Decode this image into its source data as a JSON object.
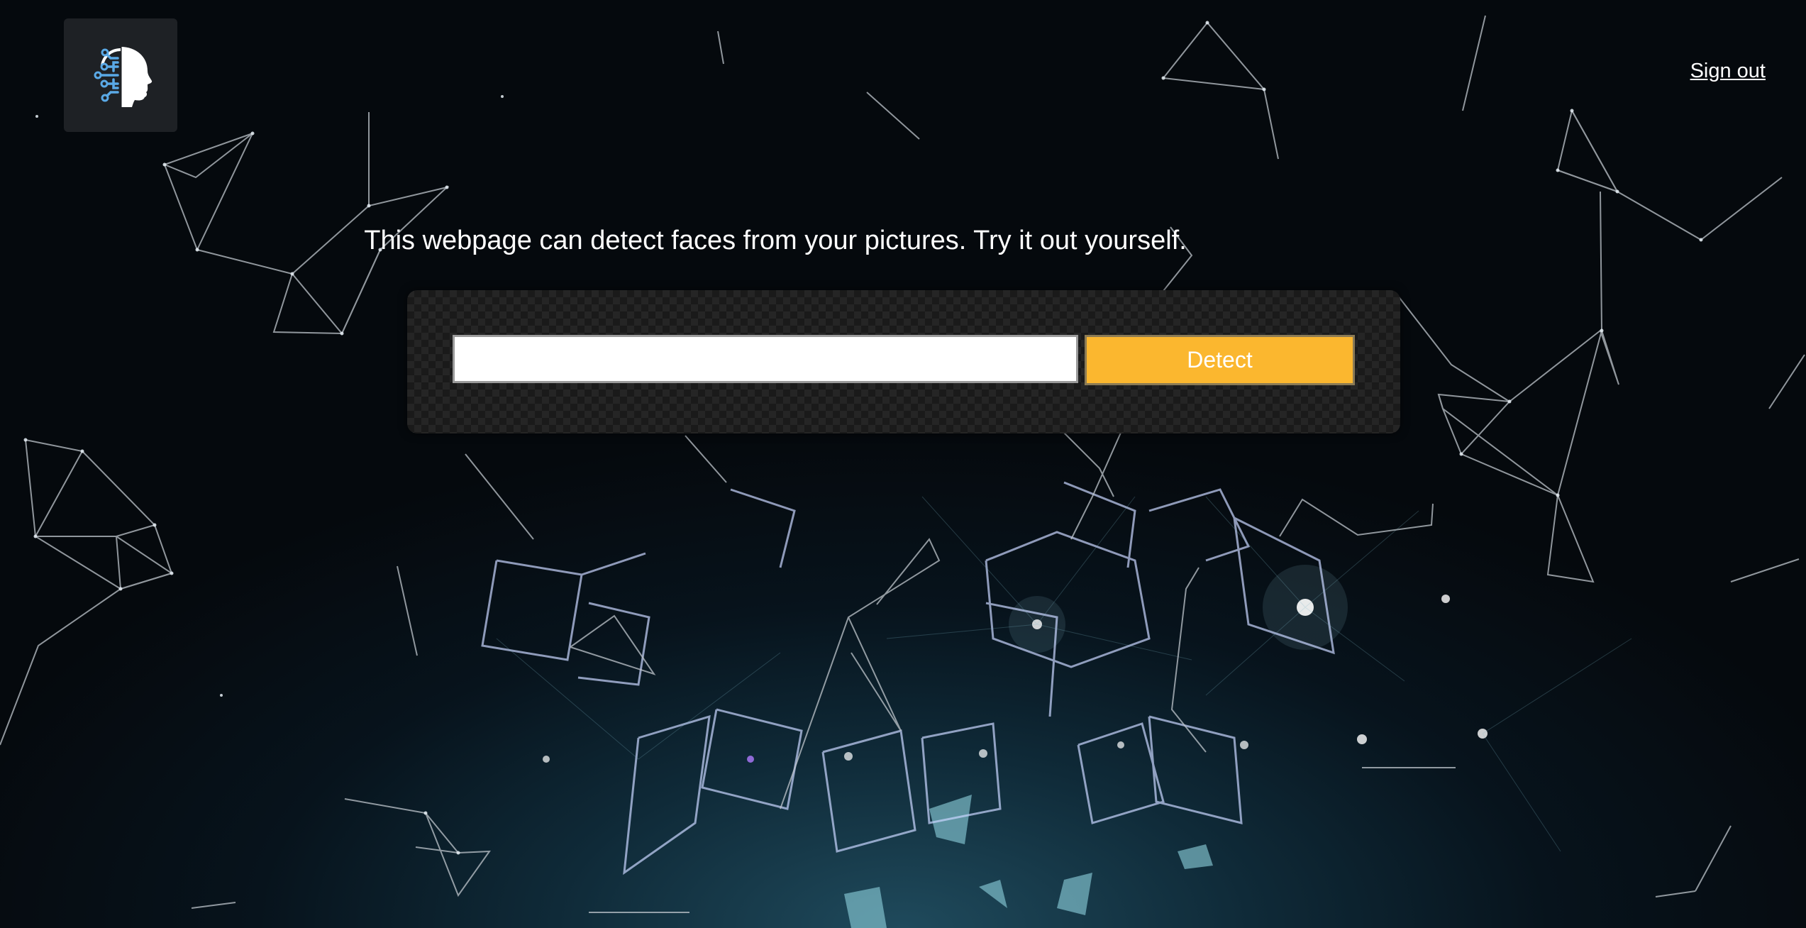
{
  "header": {
    "logo_icon": "ai-face-brain-icon",
    "signout_label": "Sign out"
  },
  "main": {
    "tagline": "This webpage can detect faces from your pictures. Try it out yourself.",
    "url_input": {
      "value": "",
      "placeholder": ""
    },
    "detect_label": "Detect"
  },
  "colors": {
    "accent": "#fbb72f",
    "logo_blue": "#5aa9e6"
  }
}
